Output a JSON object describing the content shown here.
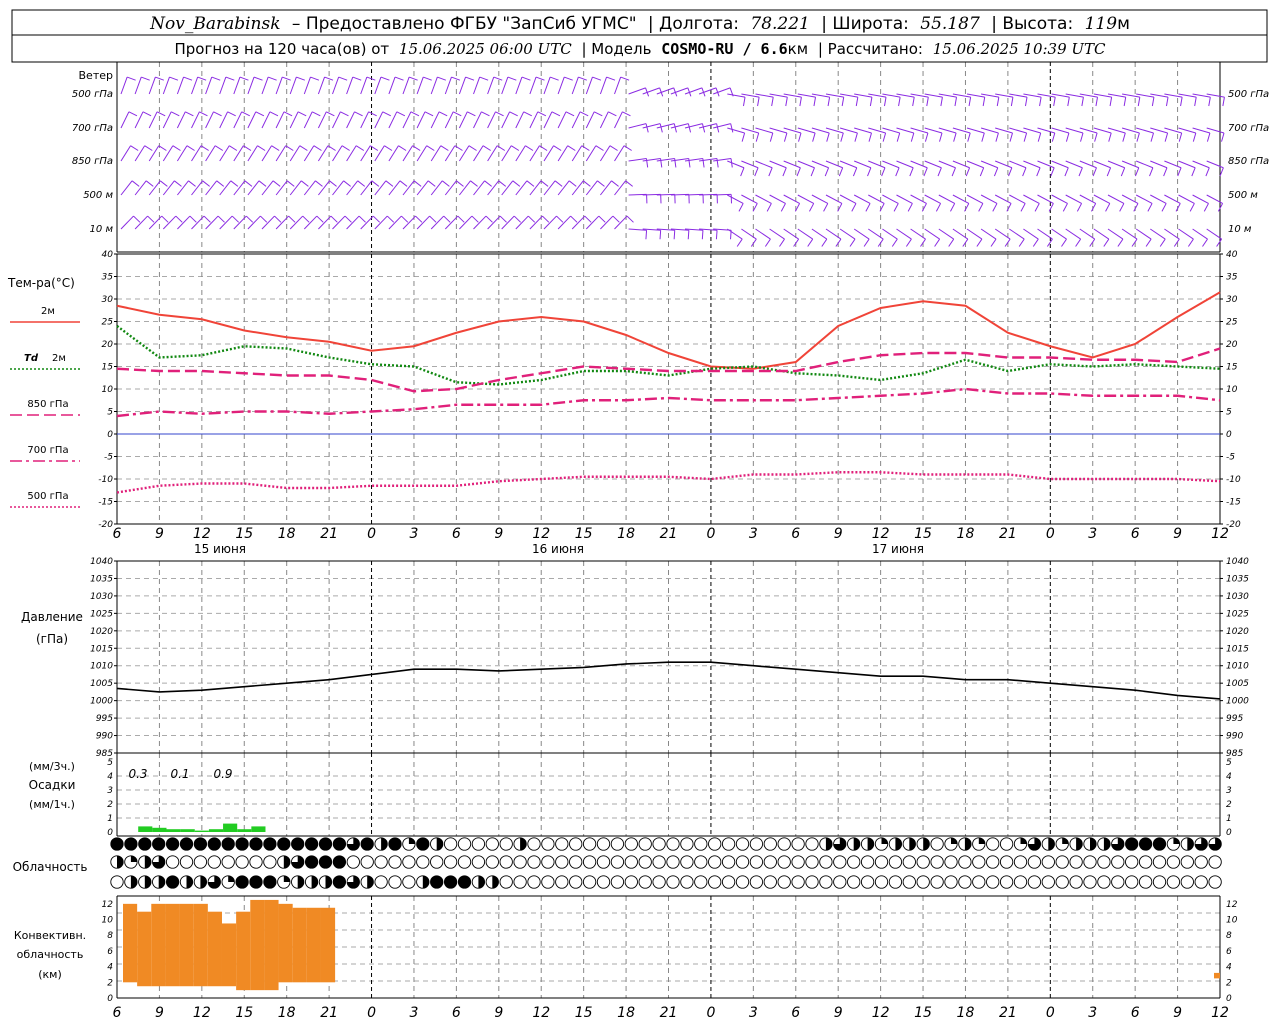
{
  "header": {
    "line1": {
      "station": "Nov_Barabinsk",
      "provider": "– Предоставлено ФГБУ \"ЗапСиб УГМС\"",
      "lon_label": "| Долгота:",
      "lon_value": "78.221",
      "lat_label": "| Широта:",
      "lat_value": "55.187",
      "alt_label": "| Высота:",
      "alt_value": "119",
      "alt_unit": "м"
    },
    "line2": {
      "forecast_label": "Прогноз на 120 часа(ов) от",
      "forecast_time": "15.06.2025 06:00 UTC",
      "model_label": "| Модель",
      "model_name": "COSMO-RU / 6.6",
      "model_unit": "км",
      "calc_label": "| Рассчитано:",
      "calc_time": "15.06.2025 10:39 UTC"
    }
  },
  "colors": {
    "t2m": "#f04438",
    "td2m": "#118811",
    "t850": "#e0207a",
    "t700": "#e0207a",
    "t500": "#e0207a",
    "pressure": "#000000",
    "precip": "#22cc22",
    "convective": "#f08a24",
    "wind": "#8a2be2",
    "zero_line": "#3344cc"
  },
  "time_axis": {
    "hour_labels": [
      "6",
      "9",
      "12",
      "15",
      "18",
      "21",
      "0",
      "3",
      "6",
      "9",
      "12",
      "15",
      "18",
      "21",
      "0",
      "3",
      "6",
      "9",
      "12",
      "15",
      "18",
      "21",
      "0",
      "3",
      "6",
      "9",
      "12"
    ],
    "day_labels": [
      "15 июня",
      "16 июня",
      "17 июня"
    ]
  },
  "chart_data": [
    {
      "type": "barbs",
      "title": "Ветер",
      "levels": [
        "500 гПа",
        "700 гПа",
        "850 гПа",
        "500 м",
        "10 м"
      ],
      "right_levels": [
        "500 гПа",
        "700 гПа",
        "850 гПа",
        "500 м",
        "10 м"
      ]
    },
    {
      "type": "line",
      "title": "Тем-ра(°C)",
      "ylim": [
        -20,
        40
      ],
      "yticks": [
        "40",
        "35",
        "30",
        "25",
        "20",
        "15",
        "10",
        "5",
        "0",
        "-5",
        "-10",
        "-15",
        "-20"
      ],
      "legend": [
        {
          "key": "t2m",
          "label": "2м",
          "style": "solid"
        },
        {
          "key": "td2m",
          "label_prefix": "Td",
          "label": "2м",
          "style": "dotted"
        },
        {
          "key": "t850",
          "label": "850 гПа",
          "style": "dashed"
        },
        {
          "key": "t700",
          "label": "700 гПа",
          "style": "dashdot"
        },
        {
          "key": "t500",
          "label": "500 гПа",
          "style": "dotted"
        }
      ],
      "x_hours": [
        0,
        3,
        6,
        9,
        12,
        15,
        18,
        21,
        24,
        27,
        30,
        33,
        36,
        39,
        42,
        45,
        48,
        51,
        54,
        57,
        60,
        63,
        66,
        69,
        72,
        75,
        78
      ],
      "series": [
        {
          "key": "t2m",
          "values": [
            28.5,
            26.5,
            25.5,
            23,
            21.5,
            20.5,
            18.5,
            19.5,
            22.5,
            25,
            26,
            25,
            22,
            18,
            15,
            14.5,
            16,
            24,
            28,
            29.5,
            28.5,
            22.5,
            19.5,
            17,
            20,
            26,
            31.5
          ]
        },
        {
          "key": "td2m",
          "values": [
            24,
            17,
            17.5,
            19.5,
            19,
            17,
            15.5,
            15,
            11.5,
            11,
            12,
            14,
            14,
            13,
            14.5,
            15,
            13.5,
            13,
            12,
            13.5,
            16.5,
            14,
            15.5,
            15,
            15.5,
            15,
            14.5
          ]
        },
        {
          "key": "t850",
          "values": [
            14.5,
            14,
            14,
            13.5,
            13,
            13,
            12,
            9.5,
            10,
            12,
            13.5,
            15,
            14.5,
            14,
            14,
            14,
            14,
            16,
            17.5,
            18,
            18,
            17,
            17,
            16.5,
            16.5,
            16,
            19
          ]
        },
        {
          "key": "t700",
          "values": [
            4,
            5,
            4.5,
            5,
            5,
            4.5,
            5,
            5.5,
            6.5,
            6.5,
            6.5,
            7.5,
            7.5,
            8,
            7.5,
            7.5,
            7.5,
            8,
            8.5,
            9,
            10,
            9,
            9,
            8.5,
            8.5,
            8.5,
            7.5
          ]
        },
        {
          "key": "t500",
          "values": [
            -13,
            -11.5,
            -11,
            -11,
            -12,
            -12,
            -11.5,
            -11.5,
            -11.5,
            -10.5,
            -10,
            -9.5,
            -9.5,
            -9.5,
            -10,
            -9,
            -9,
            -8.5,
            -8.5,
            -9,
            -9,
            -9,
            -10,
            -10,
            -10,
            -10,
            -10.5
          ]
        }
      ]
    },
    {
      "type": "line",
      "title": "Давление",
      "unit": "(гПа)",
      "ylim": [
        985,
        1040
      ],
      "yticks": [
        "1040",
        "1035",
        "1030",
        "1025",
        "1020",
        "1015",
        "1010",
        "1005",
        "1000",
        "995",
        "990",
        "985"
      ],
      "x_hours": [
        0,
        3,
        6,
        9,
        12,
        15,
        18,
        21,
        24,
        27,
        30,
        33,
        36,
        39,
        42,
        45,
        48,
        51,
        54,
        57,
        60,
        63,
        66,
        69,
        72,
        75,
        78
      ],
      "values": [
        1003.5,
        1002.5,
        1003,
        1004,
        1005,
        1006,
        1007.5,
        1009,
        1009,
        1008.5,
        1009,
        1009.5,
        1010.5,
        1011,
        1011,
        1010,
        1009,
        1008,
        1007,
        1007,
        1006,
        1006,
        1005,
        1004,
        1003,
        1001.5,
        1000.5
      ]
    },
    {
      "type": "bar",
      "title": "Осадки",
      "unit_top": "(мм/3ч.)",
      "unit_bottom": "(мм/1ч.)",
      "ylim": [
        0,
        5
      ],
      "yticks": [
        "5",
        "4",
        "3",
        "2",
        "1",
        "0"
      ],
      "labels_3h": [
        "0.3",
        "0.1",
        "0.9"
      ],
      "hourly_values": [
        0,
        0.4,
        0.3,
        0.2,
        0.2,
        0.1,
        0.2,
        0.6,
        0.2,
        0.4
      ]
    },
    {
      "type": "table",
      "title": "Облачность",
      "rows_cloud_fraction": [
        [
          1,
          1,
          1,
          1,
          1,
          1,
          1,
          1,
          1,
          1,
          1,
          1,
          1,
          1,
          1,
          1,
          1,
          0.75,
          1,
          0.5,
          1,
          0.25,
          1,
          0.5,
          0,
          0,
          0,
          0,
          0,
          0.5,
          0,
          0,
          0,
          0,
          0,
          0,
          0,
          0,
          0,
          0,
          0,
          0,
          0,
          0,
          0,
          0,
          0,
          0,
          0,
          0,
          0,
          0.5,
          0.75,
          0.5,
          0.5,
          0.25,
          0.5,
          0.5,
          0.5,
          0,
          0.25,
          0.5,
          0.25,
          0,
          0,
          0.25,
          0.75,
          0.5,
          0.25,
          0.5,
          0.5,
          0.5,
          0.75,
          1,
          1,
          1,
          0.25,
          0.5,
          0.75,
          0.75,
          0.5,
          0.5,
          0.75,
          0.75,
          0.5,
          0.75,
          0.5,
          0.75,
          0.5,
          0,
          0.25,
          0,
          0.5,
          0,
          0,
          0.5,
          0.5,
          0.5,
          0,
          0,
          0,
          0.25,
          0.5,
          1,
          1
        ],
        [
          0.5,
          0.25,
          0.5,
          0.75,
          0,
          0,
          0,
          0,
          0,
          0,
          0,
          0,
          0.5,
          0.75,
          1,
          1,
          1,
          0,
          0,
          0,
          0,
          0,
          0,
          0,
          0,
          0,
          0,
          0,
          0,
          0,
          0,
          0,
          0,
          0,
          0,
          0,
          0,
          0,
          0,
          0,
          0,
          0,
          0,
          0,
          0,
          0,
          0,
          0,
          0,
          0,
          0,
          0,
          0,
          0,
          0,
          0,
          0,
          0,
          0,
          0,
          0,
          0,
          0,
          0,
          0,
          0,
          0,
          0,
          0,
          0,
          0,
          0,
          0,
          0,
          0,
          0,
          0,
          0,
          0,
          0,
          0,
          0,
          0,
          0,
          0,
          0,
          0,
          0,
          0,
          0,
          0,
          0,
          0,
          0,
          0,
          0,
          0,
          0,
          0,
          0,
          0,
          0,
          0,
          0,
          0
        ],
        [
          0,
          0.5,
          0.5,
          0.5,
          1,
          0.5,
          0.5,
          0.75,
          0.25,
          1,
          1,
          1,
          0.25,
          0.5,
          0.5,
          0.5,
          1,
          0.75,
          0.5,
          0,
          0,
          0,
          0.5,
          1,
          1,
          1,
          0.5,
          0.5,
          0,
          0,
          0,
          0,
          0,
          0,
          0,
          0,
          0,
          0,
          0,
          0,
          0,
          0,
          0,
          0,
          0,
          0,
          0,
          0,
          0,
          0,
          0,
          0,
          0,
          0,
          0,
          0,
          0,
          0,
          0,
          0,
          0,
          0,
          0,
          0,
          0,
          0,
          0,
          0,
          0,
          0,
          0,
          0,
          0,
          0,
          0,
          0,
          0,
          0,
          0,
          0,
          0,
          0,
          0,
          0,
          0,
          0,
          0,
          0,
          0,
          0,
          0,
          0,
          0,
          0,
          0,
          0,
          0,
          0,
          0,
          0,
          0,
          0,
          0,
          0,
          0
        ]
      ]
    },
    {
      "type": "bar",
      "title": "Конвективн.",
      "title2": "облачность",
      "unit": "(км)",
      "ylim": [
        0,
        13
      ],
      "yticks": [
        "12",
        "10",
        "8",
        "6",
        "4",
        "2",
        "0"
      ],
      "bars_km": [
        [
          2,
          12
        ],
        [
          1.5,
          11
        ],
        [
          1.5,
          12
        ],
        [
          1.5,
          12
        ],
        [
          1.5,
          12
        ],
        [
          1.5,
          12
        ],
        [
          1.5,
          11
        ],
        [
          1.5,
          9.5
        ],
        [
          1,
          11
        ],
        [
          1,
          12.5
        ],
        [
          1,
          12.5
        ],
        [
          2,
          12
        ],
        [
          2,
          11.5
        ],
        [
          2,
          11.5
        ],
        [
          2,
          11.5
        ]
      ],
      "late_bars_km": [
        [
          2.5,
          3.2
        ]
      ]
    }
  ]
}
